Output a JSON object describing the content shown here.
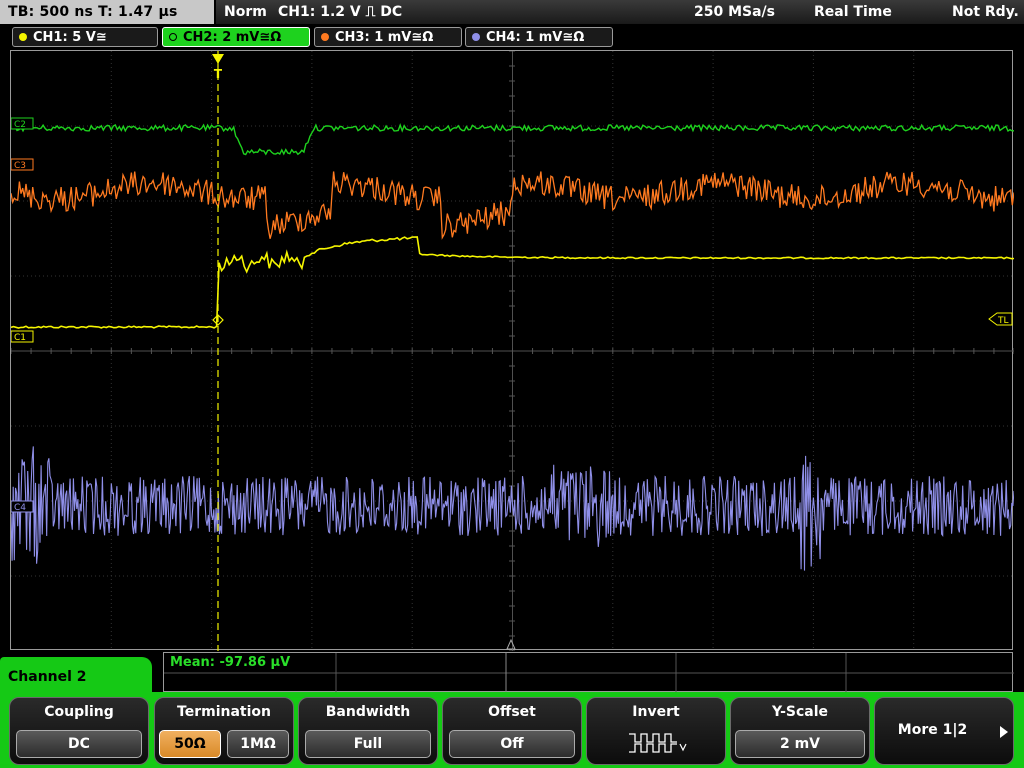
{
  "topbar": {
    "timebase": "TB: 500 ns   T: 1.47 µs",
    "mode": "Norm",
    "trigger": "CH1: 1.2 V ⎍ DC",
    "sample_rate": "250 MSa/s",
    "acq": "Real Time",
    "state": "Not Rdy."
  },
  "channels": [
    {
      "label": "CH1: 5 V≅",
      "color": "#f5f500",
      "active": false
    },
    {
      "label": "CH2: 2 mV≅Ω",
      "color": "#1ed21e",
      "active": true
    },
    {
      "label": "CH3: 1 mV≅Ω",
      "color": "#ff7a20",
      "active": false
    },
    {
      "label": "CH4: 1 mV≅Ω",
      "color": "#8f8fe8",
      "active": false
    }
  ],
  "markers": {
    "c1": "C1",
    "c2": "C2",
    "c3": "C3",
    "c4": "C4",
    "trigger_level": "TL",
    "trigger_pos": "T"
  },
  "measurement": "Mean: -97.86 µV",
  "menu": {
    "title": "Channel 2",
    "coupling_label": "Coupling",
    "coupling_value": "DC",
    "termination_label": "Termination",
    "termination_50": "50Ω",
    "termination_1m": "1MΩ",
    "bandwidth_label": "Bandwidth",
    "bandwidth_value": "Full",
    "offset_label": "Offset",
    "offset_value": "Off",
    "invert_label": "Invert",
    "yscale_label": "Y-Scale",
    "yscale_value": "2 mV",
    "more_label": "More 1|2"
  },
  "colors": {
    "ch1": "#f5f500",
    "ch2": "#1ed21e",
    "ch3": "#ff7a20",
    "ch4": "#8f8fe8",
    "menu": "#15c915"
  }
}
